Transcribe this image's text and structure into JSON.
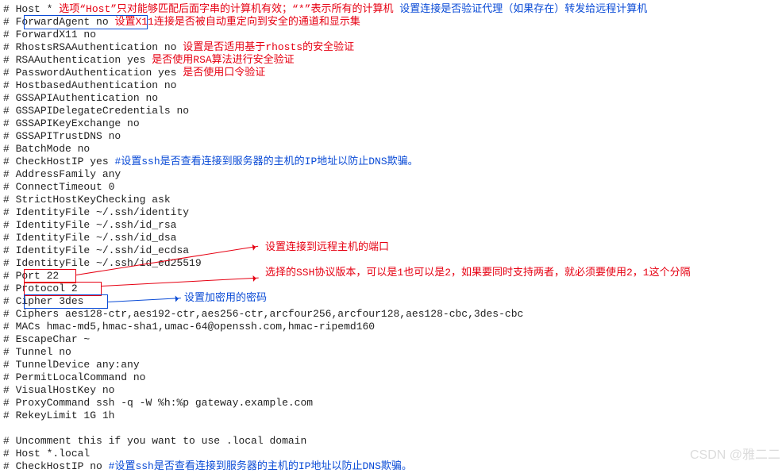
{
  "hash": "#",
  "lines": {
    "l1_cfg": " Host  *  ",
    "l1_red": "选项“Host”只对能够匹配后面字串的计算机有效；“*”表示所有的计算机",
    "l1_gap": "   ",
    "l1_blue": "设置连接是否验证代理（如果存在）转发给远程计算机",
    "l2_cfg": "   ForwardAgent no",
    "l2_gap": "   ",
    "l2_red": "设置X11连接是否被自动重定向到安全的通道和显示集",
    "l3_cfg": "   ForwardX11 no",
    "l4_cfg": "   RhostsRSAAuthentication no",
    "l4_gap": " ",
    "l4_red": "设置是否适用基于rhosts的安全验证",
    "l5_cfg": "   RSAAuthentication yes",
    "l5_gap": "   ",
    "l5_red": "是否使用RSA算法进行安全验证",
    "l6_cfg": "   PasswordAuthentication yes",
    "l6_gap": "  ",
    "l6_red": "是否使用口令验证",
    "l7_cfg": "   HostbasedAuthentication no",
    "l8_cfg": "   GSSAPIAuthentication no",
    "l9_cfg": "   GSSAPIDelegateCredentials no",
    "l10_cfg": "   GSSAPIKeyExchange no",
    "l11_cfg": "   GSSAPITrustDNS no",
    "l12_cfg": "   BatchMode no",
    "l13_cfg": "   CheckHostIP yes",
    "l13_gap": "   ",
    "l13_blue": "#设置ssh是否查看连接到服务器的主机的IP地址以防止DNS欺骗。",
    "l14_cfg": "   AddressFamily any",
    "l15_cfg": "   ConnectTimeout 0",
    "l16_cfg": "   StrictHostKeyChecking ask",
    "l17_cfg": "   IdentityFile ~/.ssh/identity",
    "l18_cfg": "   IdentityFile ~/.ssh/id_rsa",
    "l19_cfg": "   IdentityFile ~/.ssh/id_dsa",
    "l20_cfg": "   IdentityFile ~/.ssh/id_ecdsa",
    "l21_cfg": "   IdentityFile ~/.ssh/id_ed25519",
    "l22_cfg": "   Port 22",
    "l23_cfg": "   Protocol 2",
    "l24_cfg": "   Cipher 3des",
    "l25_cfg": "   Ciphers aes128-ctr,aes192-ctr,aes256-ctr,arcfour256,arcfour128,aes128-cbc,3des-cbc",
    "l26_cfg": "   MACs hmac-md5,hmac-sha1,umac-64@openssh.com,hmac-ripemd160",
    "l27_cfg": "   EscapeChar ~",
    "l28_cfg": "   Tunnel no",
    "l29_cfg": "   TunnelDevice any:any",
    "l30_cfg": "   PermitLocalCommand no",
    "l31_cfg": "   VisualHostKey no",
    "l32_cfg": "   ProxyCommand ssh -q -W %h:%p gateway.example.com",
    "l33_cfg": "   RekeyLimit 1G 1h",
    "l35_cfg": " Uncomment this if you want to use .local domain",
    "l36_cfg": " Host *.local",
    "l37_cfg": "   CheckHostIP no",
    "l37_gap": "       ",
    "l37_blue": "#设置ssh是否查看连接到服务器的主机的IP地址以防止DNS欺骗。"
  },
  "annotations": {
    "port_red": "设置连接到远程主机的端口",
    "protocol_red": "选择的SSH协议版本，可以是1也可以是2，如果要同时支持两者，就必须要使用2，1这个分隔",
    "cipher_blue": "设置加密用的密码"
  },
  "watermark": "CSDN @雅二二"
}
